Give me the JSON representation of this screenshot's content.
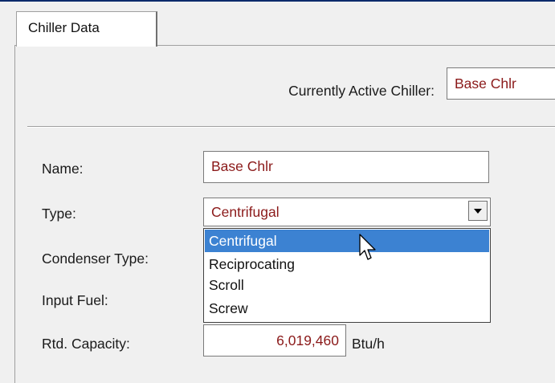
{
  "tabs": [
    {
      "label": "Chiller Data",
      "active": true
    }
  ],
  "active_chiller": {
    "label": "Currently Active Chiller:",
    "value": "Base Chlr"
  },
  "form": {
    "name": {
      "label": "Name:",
      "value": "Base Chlr"
    },
    "type": {
      "label": "Type:",
      "value": "Centrifugal"
    },
    "condenser_type": {
      "label": "Condenser Type:"
    },
    "input_fuel": {
      "label": "Input Fuel:"
    },
    "rated_capacity": {
      "label": "Rtd. Capacity:",
      "value": "6,019,460",
      "unit": "Btu/h"
    }
  },
  "type_dropdown": {
    "options": [
      "Centrifugal",
      "Reciprocating",
      "Scroll",
      "Screw"
    ],
    "highlighted": "Centrifugal"
  },
  "colors": {
    "value_text": "#8b1a1a",
    "selection": "#3c82d2",
    "background": "#f0f0f0"
  },
  "icons": {
    "dropdown_arrow": "chevron-down-icon",
    "cursor": "mouse-pointer-icon"
  }
}
